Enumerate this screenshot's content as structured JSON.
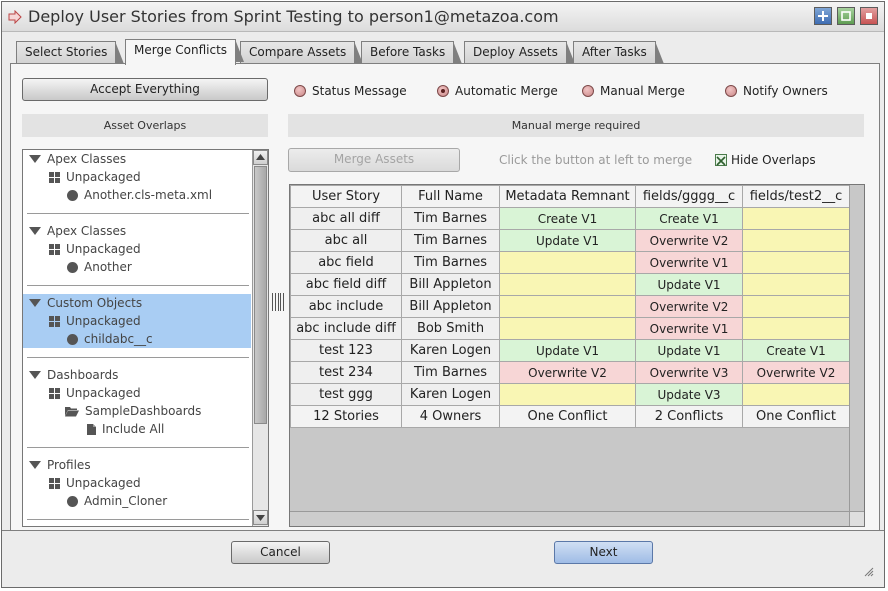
{
  "window": {
    "title": "Deploy User Stories from Sprint Testing to person1@metazoa.com"
  },
  "tabs": [
    {
      "label": "Select Stories",
      "active": false
    },
    {
      "label": "Merge Conflicts",
      "active": true
    },
    {
      "label": "Compare Assets",
      "active": false
    },
    {
      "label": "Before Tasks",
      "active": false
    },
    {
      "label": "Deploy Assets",
      "active": false
    },
    {
      "label": "After Tasks",
      "active": false
    }
  ],
  "left": {
    "accept_button": "Accept Everything",
    "overlaps_header": "Asset Overlaps",
    "tree": [
      {
        "category": "Apex Classes",
        "package": "Unpackaged",
        "items": [
          {
            "label": "Another.cls-meta.xml",
            "icon": "circle-icon"
          }
        ]
      },
      {
        "category": "Apex Classes",
        "package": "Unpackaged",
        "items": [
          {
            "label": "Another",
            "icon": "circle-icon"
          }
        ]
      },
      {
        "category": "Custom Objects",
        "package": "Unpackaged",
        "selected": true,
        "items": [
          {
            "label": "childabc__c",
            "icon": "circle-icon"
          }
        ]
      },
      {
        "category": "Dashboards",
        "package": "Unpackaged",
        "items": [
          {
            "label": "SampleDashboards",
            "icon": "folder-open-icon"
          },
          {
            "label": "Include All",
            "icon": "document-icon"
          }
        ]
      },
      {
        "category": "Profiles",
        "package": "Unpackaged",
        "items": [
          {
            "label": "Admin_Cloner",
            "icon": "circle-icon"
          }
        ]
      }
    ]
  },
  "merge_options": {
    "options": [
      "Status Message",
      "Automatic Merge",
      "Manual Merge",
      "Notify Owners"
    ],
    "selected": "Automatic Merge"
  },
  "right": {
    "status_header": "Manual merge required",
    "merge_button": "Merge Assets",
    "hint": "Click the button at left to merge th",
    "hide_overlaps_label": "Hide Overlaps",
    "hide_overlaps_checked": true
  },
  "table": {
    "columns": [
      "User Story",
      "Full Name",
      "Metadata Remnant",
      "fields/gggg__c",
      "fields/test2__c"
    ],
    "rows": [
      {
        "story": "abc all diff",
        "name": "Tim Barnes",
        "cells": [
          {
            "text": "Create V1",
            "status": "green"
          },
          {
            "text": "Create V1",
            "status": "green"
          },
          {
            "text": "",
            "status": "yellow"
          }
        ]
      },
      {
        "story": "abc all",
        "name": "Tim Barnes",
        "cells": [
          {
            "text": "Update V1",
            "status": "green"
          },
          {
            "text": "Overwrite V2",
            "status": "red"
          },
          {
            "text": "",
            "status": "yellow"
          }
        ]
      },
      {
        "story": "abc field",
        "name": "Tim Barnes",
        "cells": [
          {
            "text": "",
            "status": "yellow"
          },
          {
            "text": "Overwrite V1",
            "status": "red"
          },
          {
            "text": "",
            "status": "yellow"
          }
        ]
      },
      {
        "story": "abc field diff",
        "name": "Bill Appleton",
        "cells": [
          {
            "text": "",
            "status": "yellow"
          },
          {
            "text": "Update V1",
            "status": "green"
          },
          {
            "text": "",
            "status": "yellow"
          }
        ]
      },
      {
        "story": "abc include",
        "name": "Bill Appleton",
        "cells": [
          {
            "text": "",
            "status": "yellow"
          },
          {
            "text": "Overwrite V2",
            "status": "red"
          },
          {
            "text": "",
            "status": "yellow"
          }
        ]
      },
      {
        "story": "abc include diff",
        "name": "Bob Smith",
        "cells": [
          {
            "text": "",
            "status": "yellow"
          },
          {
            "text": "Overwrite V1",
            "status": "red"
          },
          {
            "text": "",
            "status": "yellow"
          }
        ]
      },
      {
        "story": "test 123",
        "name": "Karen Logen",
        "cells": [
          {
            "text": "Update V1",
            "status": "green"
          },
          {
            "text": "Update V1",
            "status": "green"
          },
          {
            "text": "Create V1",
            "status": "green"
          }
        ]
      },
      {
        "story": "test 234",
        "name": "Tim Barnes",
        "cells": [
          {
            "text": "Overwrite V2",
            "status": "red"
          },
          {
            "text": "Overwrite V3",
            "status": "red"
          },
          {
            "text": "Overwrite V2",
            "status": "red"
          }
        ]
      },
      {
        "story": "test ggg",
        "name": "Karen Logen",
        "cells": [
          {
            "text": "",
            "status": "yellow"
          },
          {
            "text": "Update V3",
            "status": "green"
          },
          {
            "text": "",
            "status": "yellow"
          }
        ]
      }
    ],
    "footer": [
      "12 Stories",
      "4 Owners",
      "One Conflict",
      "2 Conflicts",
      "One Conflict"
    ]
  },
  "footer": {
    "cancel_label": "Cancel",
    "next_label": "Next"
  },
  "colors": {
    "green": "#d9f4d6",
    "red": "#f7d6d6",
    "yellow": "#f9f6b4",
    "selection": "#a9cdf3"
  }
}
